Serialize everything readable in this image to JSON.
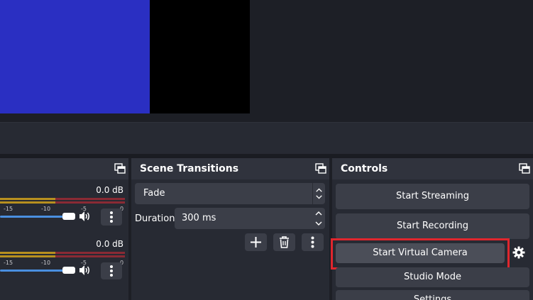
{
  "colors": {
    "preview_blue": "#2a2fc2",
    "preview_black": "#000000",
    "meter_green": "#b8901f",
    "meter_red": "#8a2a34",
    "highlight_red": "#e0262d",
    "volume_blue": "#4a8fe0"
  },
  "audio_mixer": {
    "float_icon": "float-dock-icon",
    "channels": [
      {
        "db": "0.0 dB",
        "ticks": [
          "-15",
          "-10",
          "-5",
          "0"
        ],
        "volume_level": 0.9,
        "speaker_icon": "speaker-icon",
        "menu_icon": "vertical-dots-icon"
      },
      {
        "db": "0.0 dB",
        "ticks": [
          "-15",
          "-10",
          "-5",
          "0"
        ],
        "volume_level": 0.9,
        "speaker_icon": "speaker-icon",
        "menu_icon": "vertical-dots-icon"
      }
    ]
  },
  "scene_transitions": {
    "title": "Scene Transitions",
    "float_icon": "float-dock-icon",
    "transition_value": "Fade",
    "duration_label": "Duration",
    "duration_value": "300 ms",
    "buttons": [
      "plus-icon",
      "trash-icon",
      "vertical-dots-icon"
    ]
  },
  "controls": {
    "title": "Controls",
    "float_icon": "float-dock-icon",
    "start_streaming": "Start Streaming",
    "start_recording": "Start Recording",
    "start_virtual_camera": "Start Virtual Camera",
    "virtual_camera_settings_icon": "gear-icon",
    "studio_mode": "Studio Mode",
    "settings": "Settings"
  }
}
